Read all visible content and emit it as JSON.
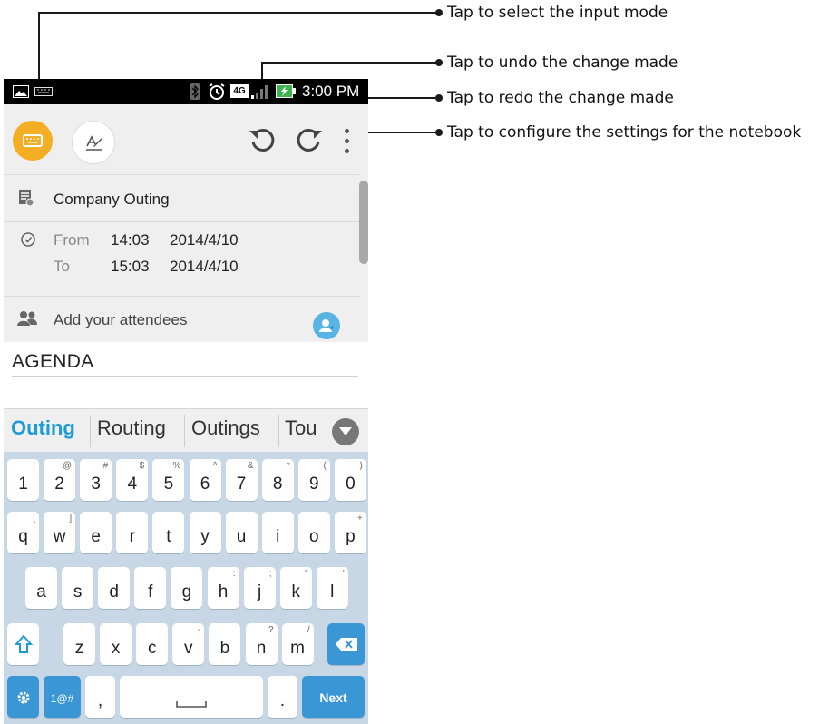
{
  "callouts": {
    "input_mode": "Tap to select the input mode",
    "undo": "Tap to undo the change made",
    "redo": "Tap to redo the change made",
    "settings": "Tap to configure the settings for the notebook"
  },
  "status_bar": {
    "time": "3:00 PM",
    "network": "4G"
  },
  "event": {
    "title": "Company Outing",
    "from_label": "From",
    "from_time": "14:03",
    "from_date": "2014/4/10",
    "to_label": "To",
    "to_time": "15:03",
    "to_date": "2014/4/10",
    "attendees_placeholder": "Add your attendees"
  },
  "note": {
    "text": "AGENDA"
  },
  "suggestions": [
    "Outing",
    "Routing",
    "Outings",
    "Tou"
  ],
  "keyboard": {
    "row1": [
      [
        "1",
        "!"
      ],
      [
        "2",
        "@"
      ],
      [
        "3",
        "#"
      ],
      [
        "4",
        "$"
      ],
      [
        "5",
        "%"
      ],
      [
        "6",
        "^"
      ],
      [
        "7",
        "&"
      ],
      [
        "8",
        "*"
      ],
      [
        "9",
        "("
      ],
      [
        "0",
        ")"
      ]
    ],
    "row2": [
      [
        "q",
        "["
      ],
      [
        "w",
        "]"
      ],
      [
        "e",
        ""
      ],
      [
        "r",
        ""
      ],
      [
        "t",
        ""
      ],
      [
        "y",
        ""
      ],
      [
        "u",
        ""
      ],
      [
        "i",
        ""
      ],
      [
        "o",
        ""
      ],
      [
        "p",
        "+"
      ]
    ],
    "row3": [
      [
        "a",
        ""
      ],
      [
        "s",
        ""
      ],
      [
        "d",
        ""
      ],
      [
        "f",
        ""
      ],
      [
        "g",
        ""
      ],
      [
        "h",
        ":"
      ],
      [
        "j",
        ";"
      ],
      [
        "k",
        "\""
      ],
      [
        "l",
        "'"
      ]
    ],
    "row4": [
      [
        "z",
        ""
      ],
      [
        "x",
        ""
      ],
      [
        "c",
        ""
      ],
      [
        "v",
        "-"
      ],
      [
        "b",
        ""
      ],
      [
        "n",
        "?"
      ],
      [
        "m",
        "/"
      ]
    ],
    "symbols_label": "1@#",
    "comma": ",",
    "period": ".",
    "next_label": "Next"
  },
  "colors": {
    "accent": "#f3ae23",
    "suggestion_active": "#1e9bd7",
    "key_blue": "#3b96d6",
    "keyboard_bg": "#c8d7e6"
  }
}
